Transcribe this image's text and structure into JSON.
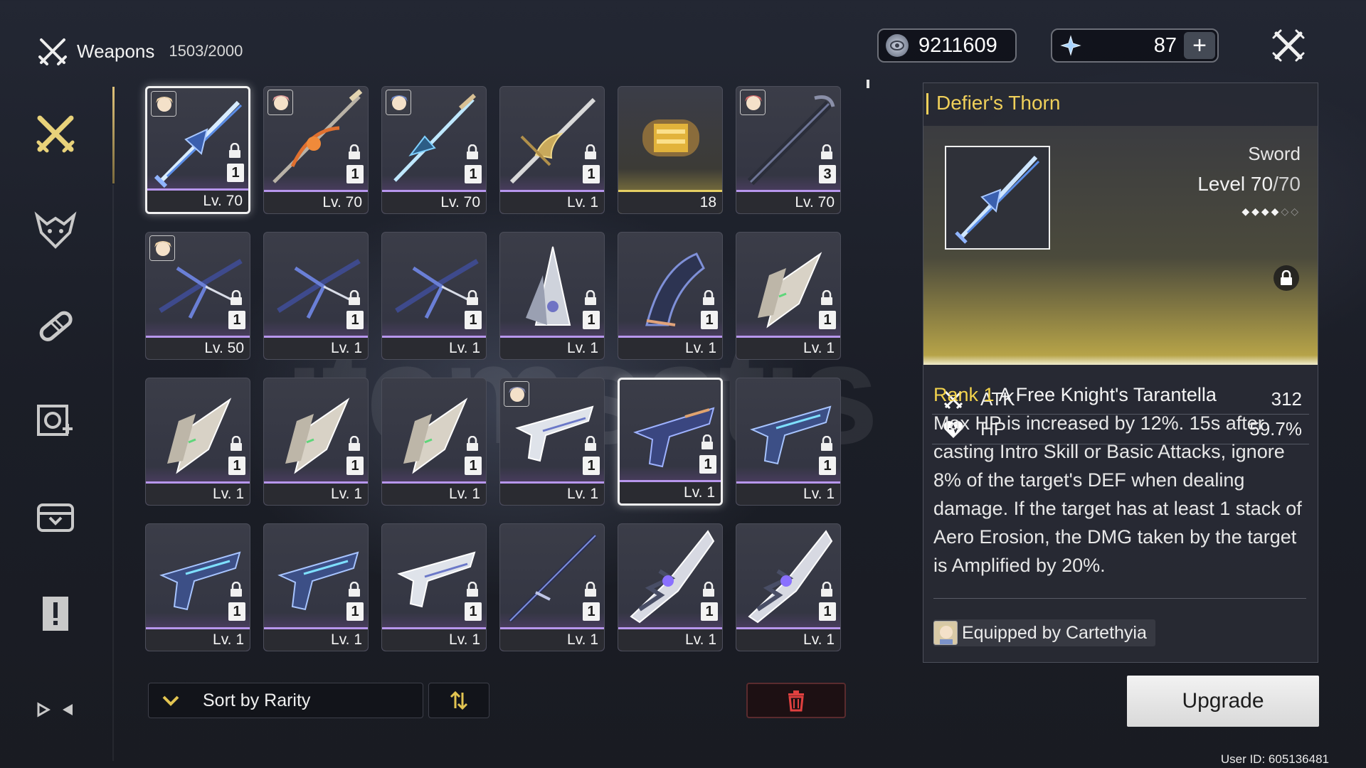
{
  "header": {
    "title": "Weapons",
    "count": "1503/2000"
  },
  "currency": {
    "shell_credits": "9211609",
    "astrite": "87",
    "plus_label": "+"
  },
  "nav": {
    "items": [
      "weapon-icon",
      "echo-icon",
      "supply-icon",
      "resonator-icon",
      "dev-material-icon",
      "quest-item-icon",
      "special-item-icon"
    ]
  },
  "grid": {
    "items": [
      {
        "level": "Lv. 70",
        "rank": "1",
        "locked": true,
        "avatar": true,
        "selected": true,
        "kind": "sword-blue"
      },
      {
        "level": "Lv. 70",
        "rank": "1",
        "locked": true,
        "avatar": true,
        "kind": "spear-orange"
      },
      {
        "level": "Lv. 70",
        "rank": "1",
        "locked": true,
        "avatar": true,
        "kind": "sword-cyan"
      },
      {
        "level": "Lv. 1",
        "rank": "1",
        "locked": true,
        "avatar": false,
        "kind": "sword-gold"
      },
      {
        "level": "18",
        "rank": "",
        "locked": false,
        "avatar": false,
        "kind": "material"
      },
      {
        "level": "Lv. 70",
        "rank": "3",
        "locked": true,
        "avatar": true,
        "kind": "broadblade"
      },
      {
        "level": "Lv. 50",
        "rank": "1",
        "locked": true,
        "avatar": true,
        "kind": "rectifier"
      },
      {
        "level": "Lv. 1",
        "rank": "1",
        "locked": true,
        "avatar": false,
        "kind": "rectifier"
      },
      {
        "level": "Lv. 1",
        "rank": "1",
        "locked": true,
        "avatar": false,
        "kind": "rectifier"
      },
      {
        "level": "Lv. 1",
        "rank": "1",
        "locked": true,
        "avatar": false,
        "kind": "gauntlet-silver"
      },
      {
        "level": "Lv. 1",
        "rank": "1",
        "locked": true,
        "avatar": false,
        "kind": "gauntlet-dark"
      },
      {
        "level": "Lv. 1",
        "rank": "1",
        "locked": true,
        "avatar": false,
        "kind": "gauntlet-white"
      },
      {
        "level": "Lv. 1",
        "rank": "1",
        "locked": true,
        "avatar": false,
        "kind": "gauntlet-white"
      },
      {
        "level": "Lv. 1",
        "rank": "1",
        "locked": true,
        "avatar": false,
        "kind": "gauntlet-white"
      },
      {
        "level": "Lv. 1",
        "rank": "1",
        "locked": true,
        "avatar": false,
        "kind": "gauntlet-white"
      },
      {
        "level": "Lv. 1",
        "rank": "1",
        "locked": true,
        "avatar": true,
        "kind": "pistol-white"
      },
      {
        "level": "Lv. 1",
        "rank": "1",
        "locked": true,
        "avatar": false,
        "selected2": true,
        "kind": "pistol-dark"
      },
      {
        "level": "Lv. 1",
        "rank": "1",
        "locked": true,
        "avatar": false,
        "kind": "pistol-blue"
      },
      {
        "level": "Lv. 1",
        "rank": "1",
        "locked": true,
        "avatar": false,
        "kind": "pistol-blue"
      },
      {
        "level": "Lv. 1",
        "rank": "1",
        "locked": true,
        "avatar": false,
        "kind": "pistol-blue"
      },
      {
        "level": "Lv. 1",
        "rank": "1",
        "locked": true,
        "avatar": false,
        "kind": "pistol-white"
      },
      {
        "level": "Lv. 1",
        "rank": "1",
        "locked": true,
        "avatar": false,
        "kind": "sword-dark"
      },
      {
        "level": "Lv. 1",
        "rank": "1",
        "locked": true,
        "avatar": false,
        "kind": "broadblade-purple"
      },
      {
        "level": "Lv. 1",
        "rank": "1",
        "locked": true,
        "avatar": false,
        "kind": "broadblade-purple"
      }
    ]
  },
  "sort": {
    "label": "Sort by Rarity"
  },
  "detail": {
    "name": "Defier's Thorn",
    "type": "Sword",
    "level_label": "Level",
    "level_current": "70",
    "level_max": "/70",
    "stars_on": "◆◆◆◆",
    "stars_off": "◇◇",
    "stats": [
      {
        "icon": "atk-icon",
        "name": "ATK",
        "value": "312"
      },
      {
        "icon": "hp-icon",
        "name": "HP",
        "value": "59.7%"
      }
    ],
    "rank_text": "Rank 1",
    "skill_name": "A Free Knight's Tarantella",
    "description": "Max HP is increased by 12%. 15s after casting Intro Skill or Basic Attacks, ignore 8% of the target's DEF when dealing damage. If the target has at least 1 stack of Aero Erosion, the DMG taken by the target is Amplified by 20%.",
    "equipped_text": "Equipped by Cartethyia"
  },
  "actions": {
    "upgrade_label": "Upgrade"
  },
  "footer": {
    "user_id": "User ID: 605136481"
  },
  "colors": {
    "accent_gold": "#f0d05a",
    "rarity_purple": "#b796ec",
    "material_gold": "#e6cf63"
  }
}
